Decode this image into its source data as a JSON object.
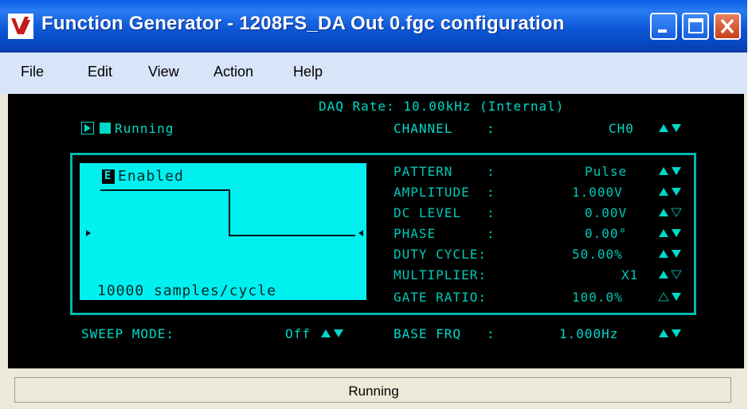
{
  "window": {
    "title": "Function Generator - 1208FS_DA Out 0.fgc configuration",
    "logo": "V",
    "buttons": [
      "minimize",
      "maximize",
      "close"
    ]
  },
  "menu": [
    "File",
    "Edit",
    "View",
    "Action",
    "Help"
  ],
  "display": {
    "daq_rate": "DAQ Rate: 10.00kHz (Internal)",
    "run_state": "Running",
    "channel_label": "CHANNEL    :",
    "channel_value": "CH0",
    "enabled_badge": "E",
    "enabled_label": "Enabled",
    "samples": "10000 samples/cycle",
    "params": [
      {
        "label": "PATTERN    :",
        "value": "Pulse"
      },
      {
        "label": "AMPLITUDE  :",
        "value": "1.000V"
      },
      {
        "label": "DC LEVEL   :",
        "value": "0.00V"
      },
      {
        "label": "PHASE      :",
        "value": "0.00°"
      },
      {
        "label": "DUTY CYCLE:",
        "value": "50.00%"
      },
      {
        "label": "MULTIPLIER:",
        "value": "X1"
      },
      {
        "label": "GATE RATIO:",
        "value": "100.0%"
      }
    ],
    "sweep_label": "SWEEP MODE:",
    "sweep_value": "Off",
    "base_label": "BASE FRQ   :",
    "base_value": "1.000Hz"
  },
  "status": {
    "text": "Running"
  },
  "colors": {
    "title_bar": "#0a5ee6",
    "panel": "#000000",
    "lcd": "#00f0f0",
    "text": "#00d8c8"
  }
}
